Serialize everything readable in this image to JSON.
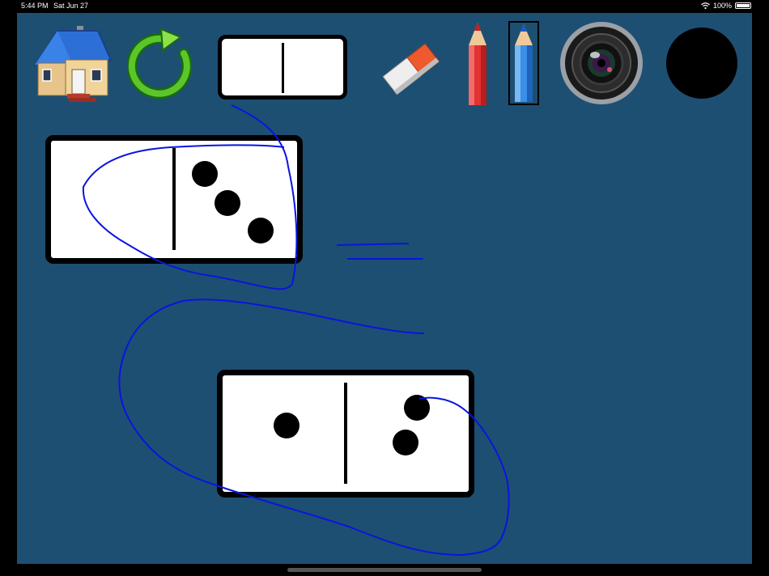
{
  "status_bar": {
    "time": "5:44 PM",
    "date": "Sat Jun 27",
    "battery": "100%",
    "icons": [
      "wifi-icon",
      "battery-icon"
    ]
  },
  "toolbar": {
    "tools": [
      {
        "name": "home-button",
        "icon": "house-icon"
      },
      {
        "name": "refresh-button",
        "icon": "green-circular-arrow-icon"
      },
      {
        "name": "blank-domino-button",
        "icon": "blank-domino-icon"
      },
      {
        "name": "eraser-button",
        "icon": "eraser-icon"
      },
      {
        "name": "red-pencil-button",
        "icon": "red-pencil-icon"
      },
      {
        "name": "blue-pencil-button",
        "icon": "blue-pencil-icon",
        "selected": true
      },
      {
        "name": "camera-button",
        "icon": "camera-lens-icon"
      },
      {
        "name": "color-swatch-button",
        "icon": "black-circle-icon",
        "color": "#000000"
      }
    ]
  },
  "dominoes": [
    {
      "name": "domino-0-3",
      "left_pips": 0,
      "right_pips": 3
    },
    {
      "name": "domino-1-2",
      "left_pips": 1,
      "right_pips": 2
    }
  ],
  "colors": {
    "canvas_background": "#1d4f72",
    "ink": "#0a14e0",
    "domino_face": "#ffffff",
    "domino_border": "#000000"
  }
}
